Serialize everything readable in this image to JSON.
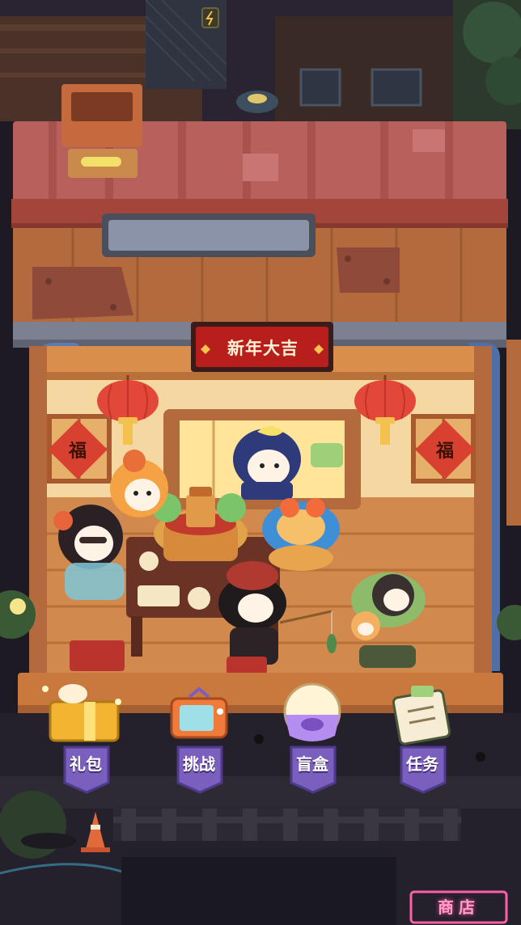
{
  "restaurant": {
    "sign_text": "新年大吉",
    "decor_glyph": "福"
  },
  "menu": [
    {
      "id": "gift",
      "label": "礼包",
      "icon": "gift-box-icon",
      "color": "#f2b431"
    },
    {
      "id": "challenge",
      "label": "挑战",
      "icon": "tv-icon",
      "color": "#ef7a3a"
    },
    {
      "id": "blindbox",
      "label": "盲盒",
      "icon": "blind-box-icon",
      "color": "#b58cf0"
    },
    {
      "id": "tasks",
      "label": "任务",
      "icon": "clipboard-icon",
      "color": "#9fd17c"
    }
  ],
  "shop": {
    "label": "商店"
  },
  "colors": {
    "roof": "#b7605c",
    "wall": "#b36b3e",
    "lantern": "#e2473a",
    "sign_bg": "#b81f1c",
    "menu_shield": "#7a5fbf",
    "night_bg": "#1d1a24"
  }
}
